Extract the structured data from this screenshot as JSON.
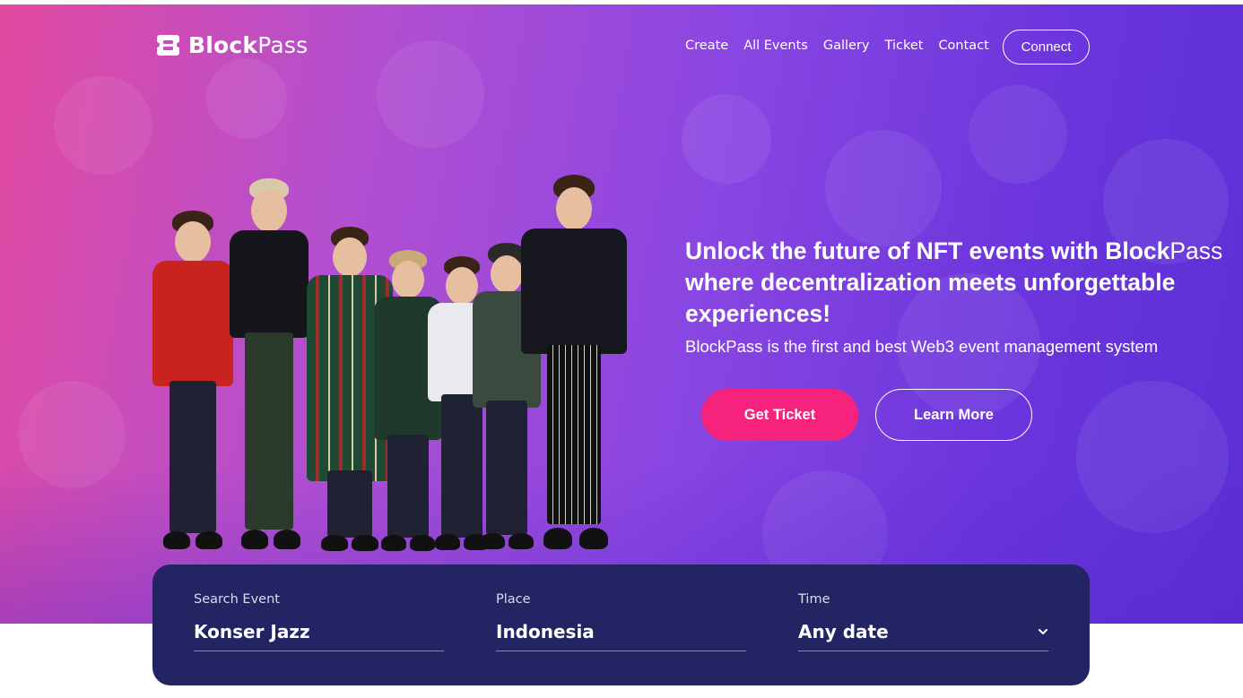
{
  "brand": {
    "name_bold": "Block",
    "name_light": "Pass",
    "logo_icon": "ticket-icon"
  },
  "nav": {
    "items": [
      "Create",
      "All Events",
      "Gallery",
      "Ticket",
      "Contact"
    ],
    "connect_label": "Connect"
  },
  "hero": {
    "headline_part1": "Unlock the future of NFT events with Block",
    "headline_part2": "Pass",
    "headline_part3": " where decentralization meets unforgettable experiences!",
    "subline": "BlockPass is the first and best Web3 event management system",
    "primary_button": "Get Ticket",
    "secondary_button": "Learn More"
  },
  "search": {
    "event": {
      "label": "Search Event",
      "value": "Konser Jazz"
    },
    "place": {
      "label": "Place",
      "value": "Indonesia"
    },
    "time": {
      "label": "Time",
      "value": "Any date",
      "icon": "chevron-down-icon"
    }
  },
  "colors": {
    "accent": "#f6237d",
    "panel": "#232463",
    "gradient_start": "#e24aa0",
    "gradient_end": "#5b2fd6"
  }
}
